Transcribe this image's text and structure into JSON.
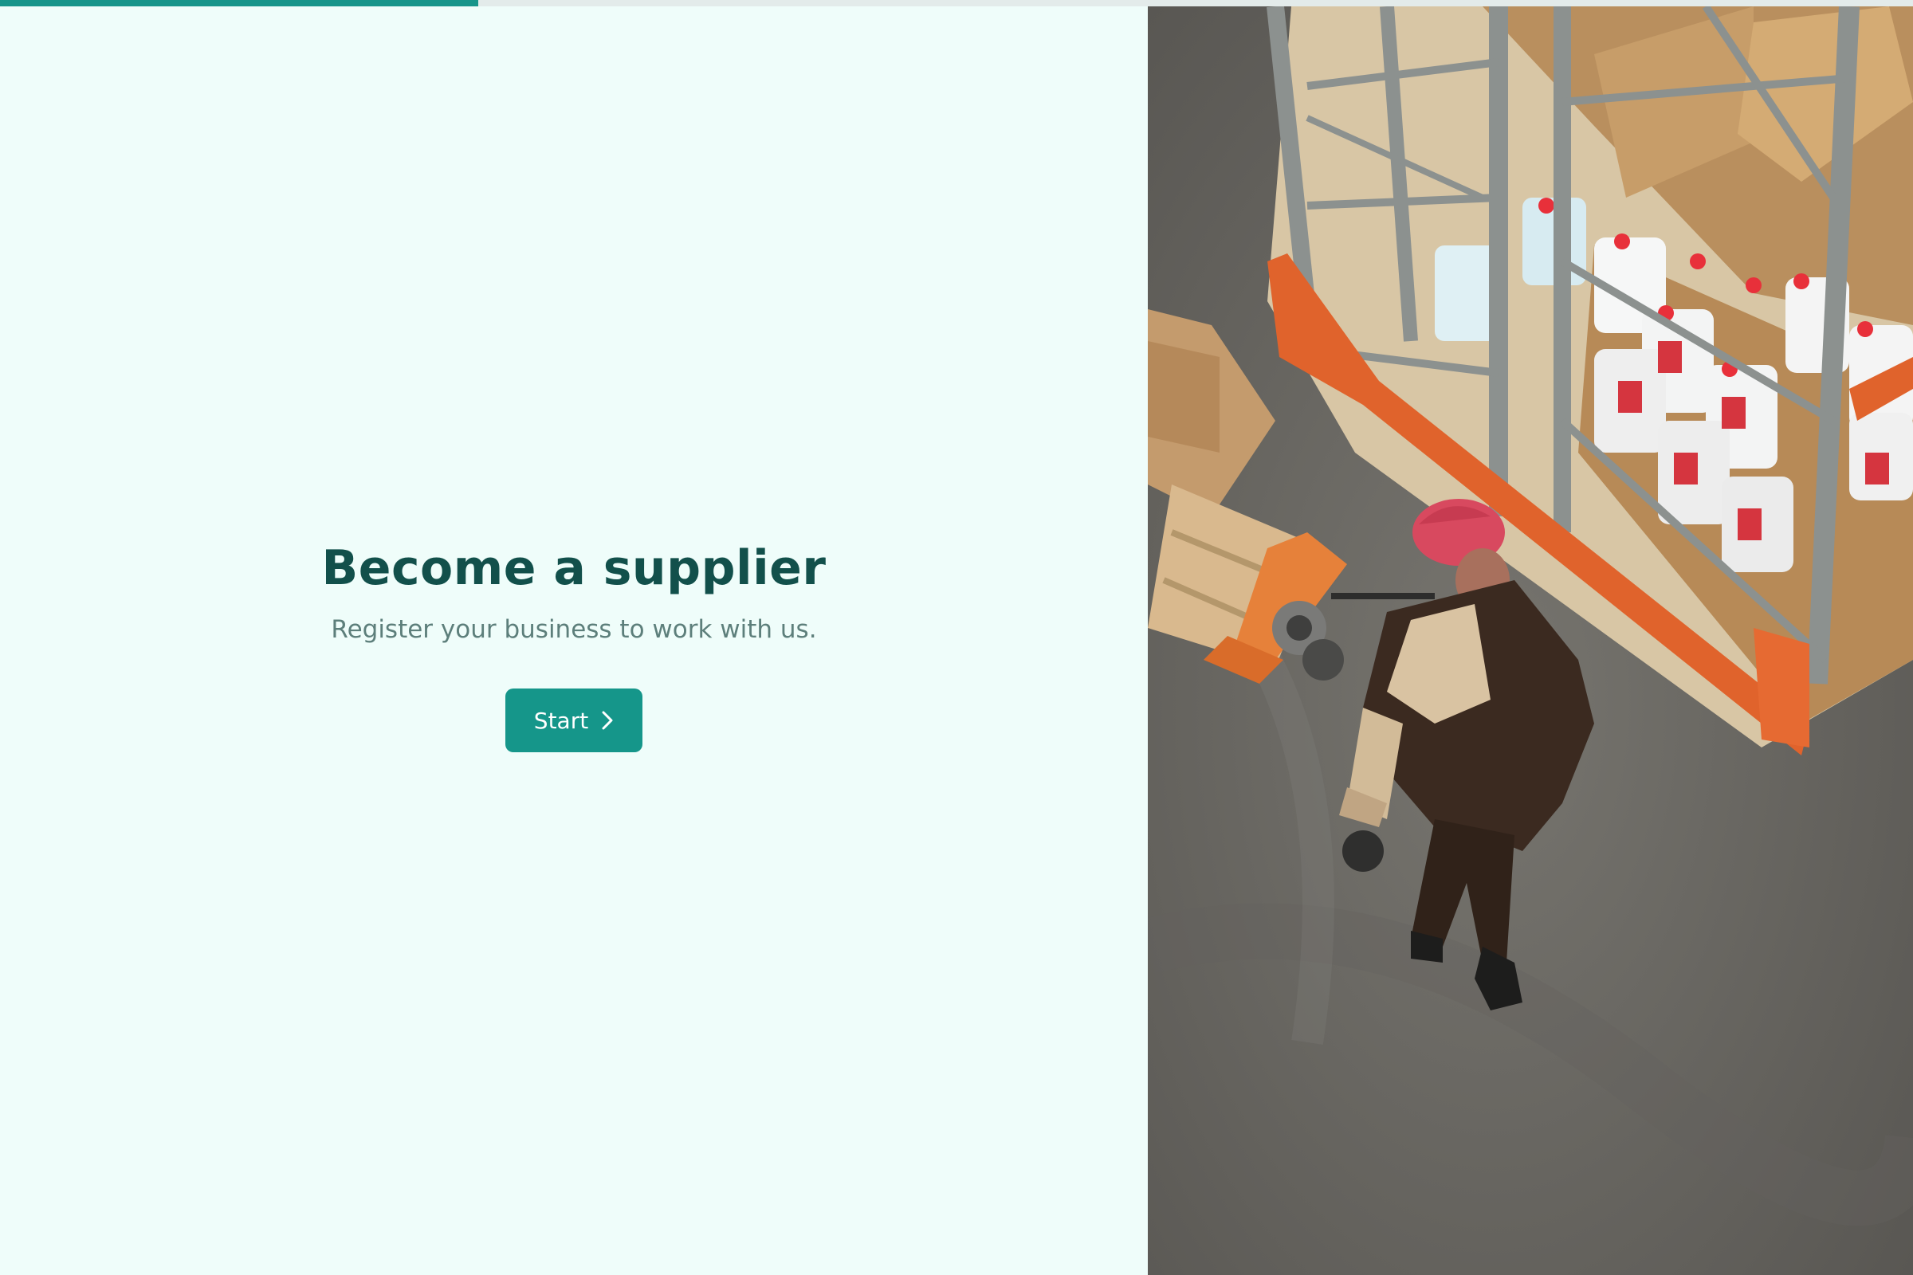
{
  "progress": {
    "fraction": 0.25,
    "color": "#17958a",
    "track_color": "#e3ebea"
  },
  "intro": {
    "title": "Become a supplier",
    "subtitle": "Register your business to work with us.",
    "start_label": "Start",
    "start_icon": "chevron-right-icon"
  },
  "hero_image": {
    "subject": "warehouse-worker-photo"
  },
  "colors": {
    "background": "#effdfa",
    "title": "#12504b",
    "subtitle": "#5d7f7b",
    "button": "#15968a",
    "button_text": "#ffffff"
  }
}
